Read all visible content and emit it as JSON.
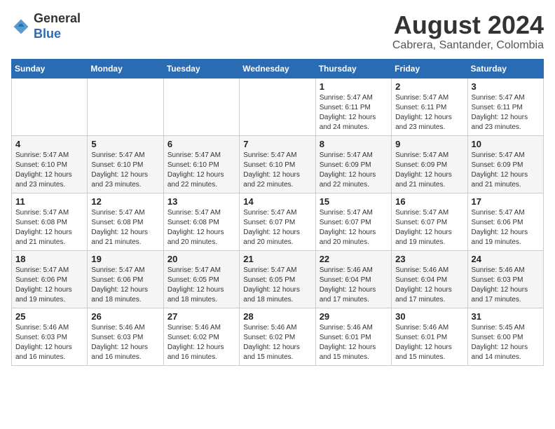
{
  "logo": {
    "general": "General",
    "blue": "Blue"
  },
  "title": "August 2024",
  "subtitle": "Cabrera, Santander, Colombia",
  "days_of_week": [
    "Sunday",
    "Monday",
    "Tuesday",
    "Wednesday",
    "Thursday",
    "Friday",
    "Saturday"
  ],
  "weeks": [
    [
      {
        "day": "",
        "info": ""
      },
      {
        "day": "",
        "info": ""
      },
      {
        "day": "",
        "info": ""
      },
      {
        "day": "",
        "info": ""
      },
      {
        "day": "1",
        "info": "Sunrise: 5:47 AM\nSunset: 6:11 PM\nDaylight: 12 hours\nand 24 minutes."
      },
      {
        "day": "2",
        "info": "Sunrise: 5:47 AM\nSunset: 6:11 PM\nDaylight: 12 hours\nand 23 minutes."
      },
      {
        "day": "3",
        "info": "Sunrise: 5:47 AM\nSunset: 6:11 PM\nDaylight: 12 hours\nand 23 minutes."
      }
    ],
    [
      {
        "day": "4",
        "info": "Sunrise: 5:47 AM\nSunset: 6:10 PM\nDaylight: 12 hours\nand 23 minutes."
      },
      {
        "day": "5",
        "info": "Sunrise: 5:47 AM\nSunset: 6:10 PM\nDaylight: 12 hours\nand 23 minutes."
      },
      {
        "day": "6",
        "info": "Sunrise: 5:47 AM\nSunset: 6:10 PM\nDaylight: 12 hours\nand 22 minutes."
      },
      {
        "day": "7",
        "info": "Sunrise: 5:47 AM\nSunset: 6:10 PM\nDaylight: 12 hours\nand 22 minutes."
      },
      {
        "day": "8",
        "info": "Sunrise: 5:47 AM\nSunset: 6:09 PM\nDaylight: 12 hours\nand 22 minutes."
      },
      {
        "day": "9",
        "info": "Sunrise: 5:47 AM\nSunset: 6:09 PM\nDaylight: 12 hours\nand 21 minutes."
      },
      {
        "day": "10",
        "info": "Sunrise: 5:47 AM\nSunset: 6:09 PM\nDaylight: 12 hours\nand 21 minutes."
      }
    ],
    [
      {
        "day": "11",
        "info": "Sunrise: 5:47 AM\nSunset: 6:08 PM\nDaylight: 12 hours\nand 21 minutes."
      },
      {
        "day": "12",
        "info": "Sunrise: 5:47 AM\nSunset: 6:08 PM\nDaylight: 12 hours\nand 21 minutes."
      },
      {
        "day": "13",
        "info": "Sunrise: 5:47 AM\nSunset: 6:08 PM\nDaylight: 12 hours\nand 20 minutes."
      },
      {
        "day": "14",
        "info": "Sunrise: 5:47 AM\nSunset: 6:07 PM\nDaylight: 12 hours\nand 20 minutes."
      },
      {
        "day": "15",
        "info": "Sunrise: 5:47 AM\nSunset: 6:07 PM\nDaylight: 12 hours\nand 20 minutes."
      },
      {
        "day": "16",
        "info": "Sunrise: 5:47 AM\nSunset: 6:07 PM\nDaylight: 12 hours\nand 19 minutes."
      },
      {
        "day": "17",
        "info": "Sunrise: 5:47 AM\nSunset: 6:06 PM\nDaylight: 12 hours\nand 19 minutes."
      }
    ],
    [
      {
        "day": "18",
        "info": "Sunrise: 5:47 AM\nSunset: 6:06 PM\nDaylight: 12 hours\nand 19 minutes."
      },
      {
        "day": "19",
        "info": "Sunrise: 5:47 AM\nSunset: 6:06 PM\nDaylight: 12 hours\nand 18 minutes."
      },
      {
        "day": "20",
        "info": "Sunrise: 5:47 AM\nSunset: 6:05 PM\nDaylight: 12 hours\nand 18 minutes."
      },
      {
        "day": "21",
        "info": "Sunrise: 5:47 AM\nSunset: 6:05 PM\nDaylight: 12 hours\nand 18 minutes."
      },
      {
        "day": "22",
        "info": "Sunrise: 5:46 AM\nSunset: 6:04 PM\nDaylight: 12 hours\nand 17 minutes."
      },
      {
        "day": "23",
        "info": "Sunrise: 5:46 AM\nSunset: 6:04 PM\nDaylight: 12 hours\nand 17 minutes."
      },
      {
        "day": "24",
        "info": "Sunrise: 5:46 AM\nSunset: 6:03 PM\nDaylight: 12 hours\nand 17 minutes."
      }
    ],
    [
      {
        "day": "25",
        "info": "Sunrise: 5:46 AM\nSunset: 6:03 PM\nDaylight: 12 hours\nand 16 minutes."
      },
      {
        "day": "26",
        "info": "Sunrise: 5:46 AM\nSunset: 6:03 PM\nDaylight: 12 hours\nand 16 minutes."
      },
      {
        "day": "27",
        "info": "Sunrise: 5:46 AM\nSunset: 6:02 PM\nDaylight: 12 hours\nand 16 minutes."
      },
      {
        "day": "28",
        "info": "Sunrise: 5:46 AM\nSunset: 6:02 PM\nDaylight: 12 hours\nand 15 minutes."
      },
      {
        "day": "29",
        "info": "Sunrise: 5:46 AM\nSunset: 6:01 PM\nDaylight: 12 hours\nand 15 minutes."
      },
      {
        "day": "30",
        "info": "Sunrise: 5:46 AM\nSunset: 6:01 PM\nDaylight: 12 hours\nand 15 minutes."
      },
      {
        "day": "31",
        "info": "Sunrise: 5:45 AM\nSunset: 6:00 PM\nDaylight: 12 hours\nand 14 minutes."
      }
    ]
  ]
}
